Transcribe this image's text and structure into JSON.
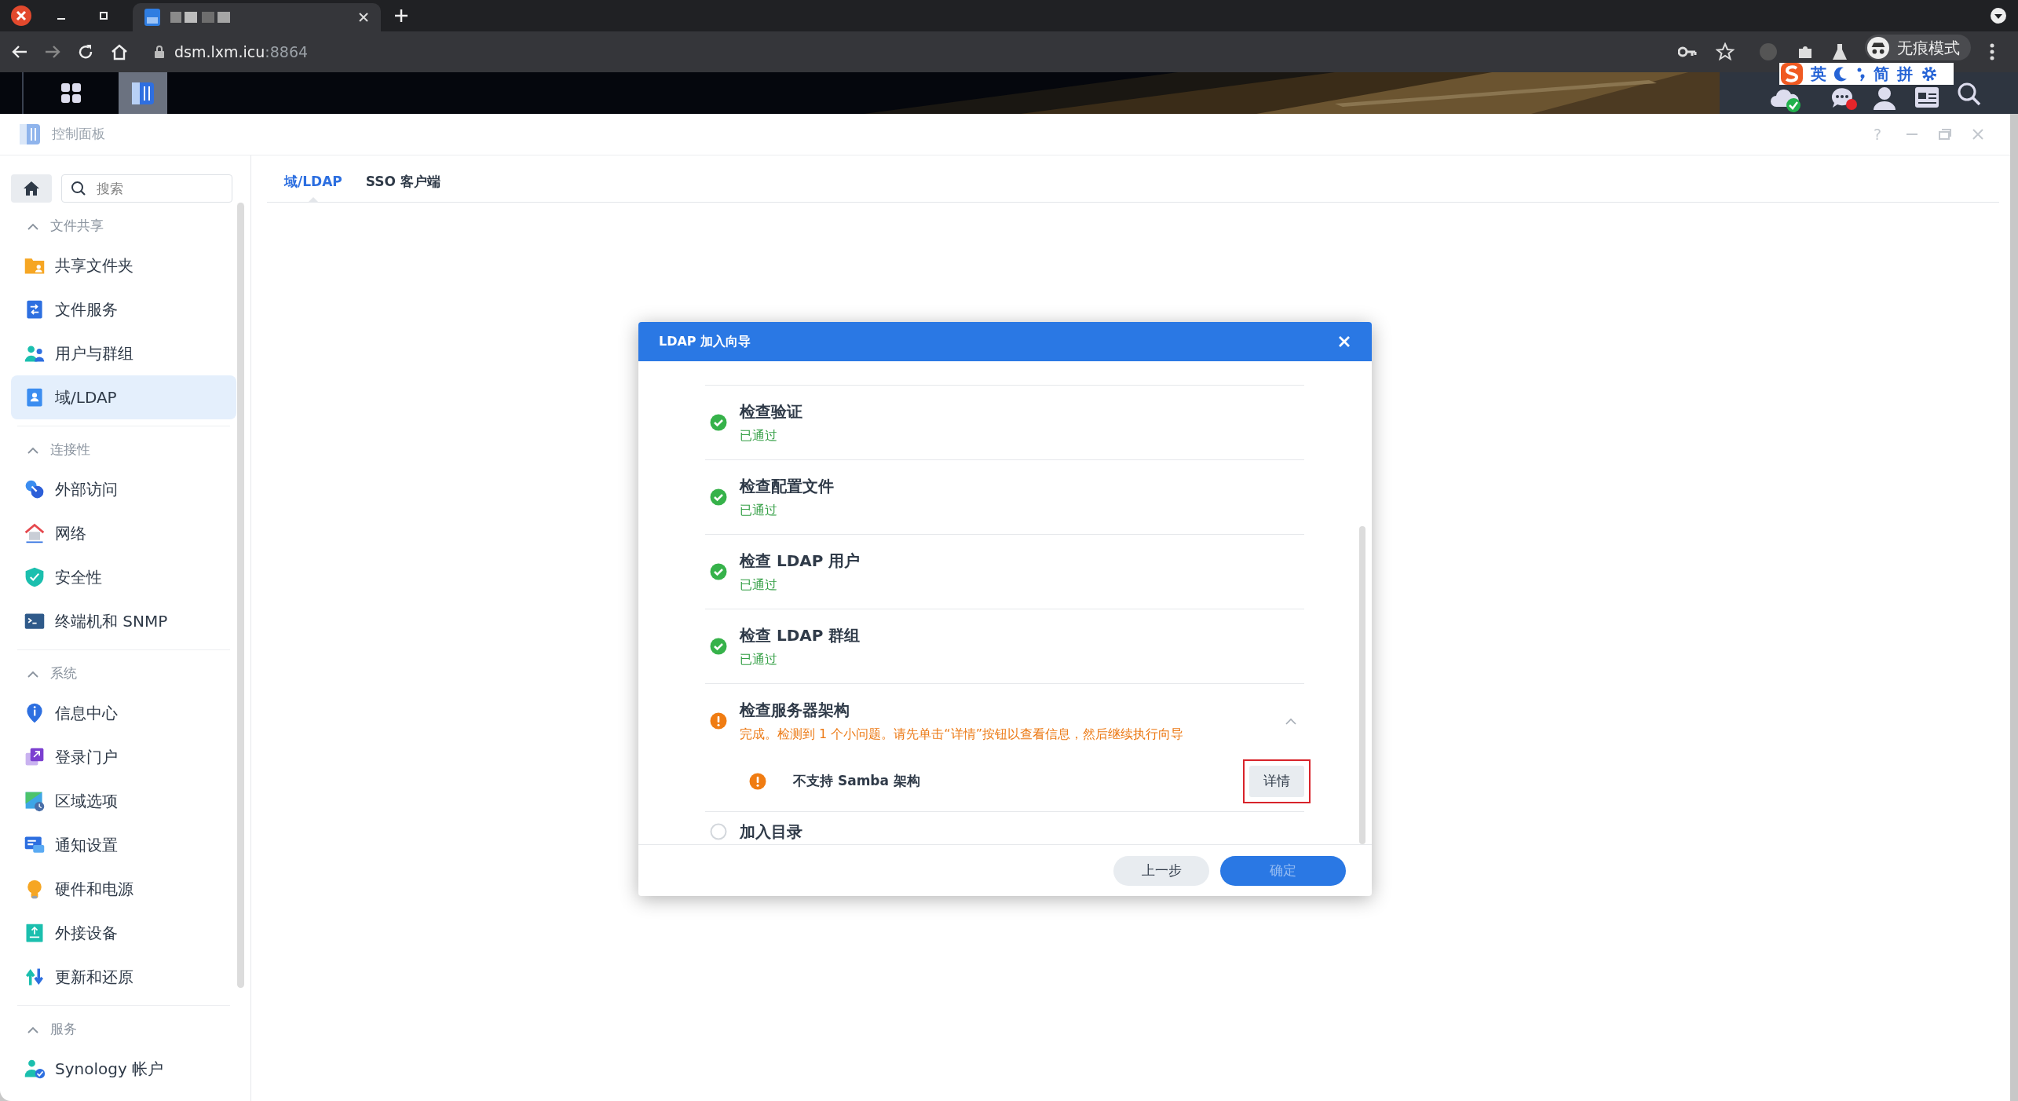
{
  "browser": {
    "url_host": "dsm.lxm.icu",
    "url_port": ":8864",
    "incognito_label": "无痕模式",
    "ime": [
      "英",
      "简",
      "拼"
    ]
  },
  "window": {
    "title": "控制面板",
    "help": "?"
  },
  "search": {
    "placeholder": "搜索"
  },
  "sidebar": {
    "groups": [
      {
        "label": "文件共享",
        "expanded": true,
        "items": [
          {
            "label": "共享文件夹",
            "selected": false
          },
          {
            "label": "文件服务",
            "selected": false
          },
          {
            "label": "用户与群组",
            "selected": false
          },
          {
            "label": "域/LDAP",
            "selected": true
          }
        ]
      },
      {
        "label": "连接性",
        "expanded": true,
        "items": [
          {
            "label": "外部访问",
            "selected": false
          },
          {
            "label": "网络",
            "selected": false
          },
          {
            "label": "安全性",
            "selected": false
          },
          {
            "label": "终端机和 SNMP",
            "selected": false
          }
        ]
      },
      {
        "label": "系统",
        "expanded": true,
        "items": [
          {
            "label": "信息中心",
            "selected": false
          },
          {
            "label": "登录门户",
            "selected": false
          },
          {
            "label": "区域选项",
            "selected": false
          },
          {
            "label": "通知设置",
            "selected": false
          },
          {
            "label": "硬件和电源",
            "selected": false
          },
          {
            "label": "外接设备",
            "selected": false
          },
          {
            "label": "更新和还原",
            "selected": false
          }
        ]
      },
      {
        "label": "服务",
        "expanded": true,
        "items": [
          {
            "label": "Synology 帐户",
            "selected": false
          }
        ]
      }
    ]
  },
  "tabs": [
    {
      "label": "域/LDAP",
      "selected": true
    },
    {
      "label": "SSO 客户端",
      "selected": false
    }
  ],
  "dialog": {
    "title": "LDAP 加入向导",
    "steps": [
      {
        "title": "检查验证",
        "kind": "passed",
        "message": "已通过"
      },
      {
        "title": "检查配置文件",
        "kind": "passed",
        "message": "已通过"
      },
      {
        "title": "检查 LDAP 用户",
        "kind": "passed",
        "message": "已通过"
      },
      {
        "title": "检查 LDAP 群组",
        "kind": "passed",
        "message": "已通过"
      },
      {
        "title": "检查服务器架构",
        "kind": "warning",
        "message": "完成。检测到 1 个小问题。请先单击“详情”按钮以查看信息，然后继续执行向导",
        "expanded": true,
        "issues": [
          {
            "text": "不支持 Samba 架构",
            "button": "详情",
            "highlighted": true
          }
        ]
      },
      {
        "title": "加入目录",
        "kind": "pending"
      }
    ],
    "buttons": [
      {
        "label": "上一步",
        "kind": "secondary",
        "disabled": false
      },
      {
        "label": "确定",
        "kind": "primary",
        "disabled": true
      }
    ]
  }
}
